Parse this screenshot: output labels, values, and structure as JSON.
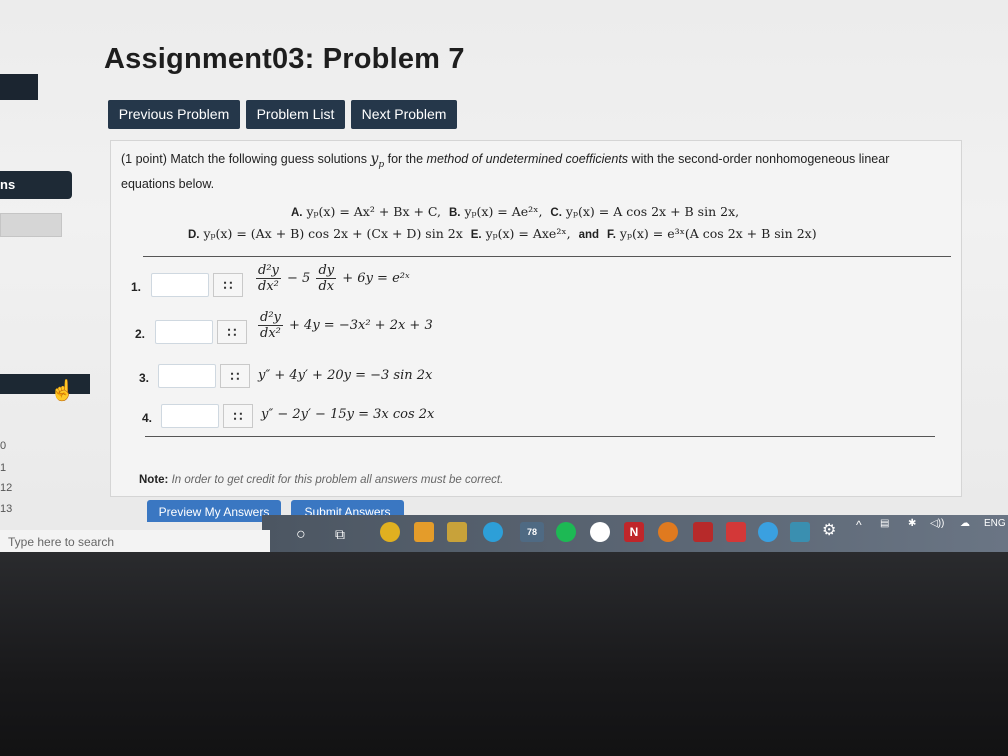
{
  "title": "Assignment03: Problem 7",
  "nav": {
    "prev": "Previous Problem",
    "list": "Problem List",
    "next": "Next Problem"
  },
  "sidebar": {
    "label": "ns",
    "numbers": [
      "0",
      "1",
      "12",
      "13"
    ]
  },
  "problem": {
    "intro_prefix": "(1 point) Match the following guess solutions",
    "intro_var": "y",
    "intro_sub": "p",
    "intro_for": "for the",
    "intro_method": "method of undetermined coefficients",
    "intro_suffix": "with the second-order nonhomogeneous linear equations below.",
    "options_line1": [
      {
        "label": "A.",
        "expr": "yₚ(x) = Ax² + Bx + C,"
      },
      {
        "label": "B.",
        "expr": "yₚ(x) = Ae²ˣ,"
      },
      {
        "label": "C.",
        "expr": "yₚ(x) = A cos 2x + B sin 2x,"
      }
    ],
    "options_line2": [
      {
        "label": "D.",
        "expr": "yₚ(x) = (Ax + B) cos 2x + (Cx + D) sin 2x"
      },
      {
        "label": "E.",
        "expr": "yₚ(x) = Axe²ˣ,"
      },
      {
        "label": "and",
        "expr": ""
      },
      {
        "label": "F.",
        "expr": "yₚ(x) = e³ˣ(A cos 2x + B sin 2x)"
      }
    ],
    "questions": [
      {
        "num": "1.",
        "value": "",
        "lhs_top": "d²y",
        "lhs_bot": "dx²",
        "mid": "− 5",
        "mid_top": "dy",
        "mid_bot": "dx",
        "rhs": "+ 6y = e²ˣ"
      },
      {
        "num": "2.",
        "value": "",
        "lhs_top": "d²y",
        "lhs_bot": "dx²",
        "rhs": "+ 4y = −3x² + 2x + 3"
      },
      {
        "num": "3.",
        "value": "",
        "eq": "y″ + 4y′ + 20y = −3 sin 2x"
      },
      {
        "num": "4.",
        "value": "",
        "eq": "y″ − 2y′ − 15y = 3x cos 2x"
      }
    ],
    "grid_glyph": "∷"
  },
  "note": {
    "label": "Note:",
    "text": "In order to get credit for this problem all answers must be correct."
  },
  "buttons": {
    "preview": "Preview My Answers",
    "submit": "Submit Answers"
  },
  "taskbar": {
    "search_placeholder": "Type here to search",
    "badge": "78",
    "lang": "ENG"
  }
}
